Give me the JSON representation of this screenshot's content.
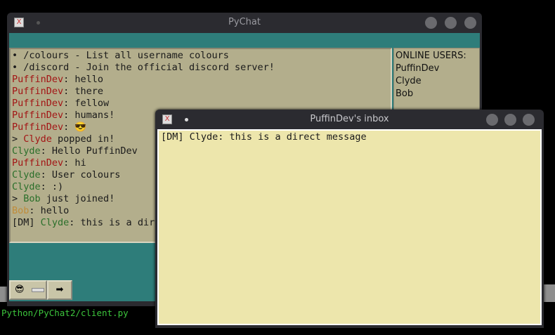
{
  "terminal": {
    "path": "Python/PyChat2/client.py"
  },
  "main_window": {
    "title": "PyChat",
    "messages": [
      {
        "pre": "• /colours - List all username colours"
      },
      {
        "pre": "• /discord - Join the official discord server!"
      },
      {
        "user": "PuffinDev",
        "color": "r",
        "text": ": hello"
      },
      {
        "user": "PuffinDev",
        "color": "r",
        "text": ": there"
      },
      {
        "user": "PuffinDev",
        "color": "r",
        "text": ": fellow"
      },
      {
        "user": "PuffinDev",
        "color": "r",
        "text": ": humans!"
      },
      {
        "user": "PuffinDev",
        "color": "r",
        "text": ": 😎"
      },
      {
        "pre": "> ",
        "user": "Clyde",
        "color": "r",
        "text": " popped in!"
      },
      {
        "user": "Clyde",
        "color": "g",
        "text": ": Hello PuffinDev"
      },
      {
        "user": "PuffinDev",
        "color": "r",
        "text": ": hi"
      },
      {
        "user": "Clyde",
        "color": "g",
        "text": ": User colours"
      },
      {
        "user": "Clyde",
        "color": "g",
        "text": ": :)"
      },
      {
        "pre": "> ",
        "user": "Bob",
        "color": "g",
        "text": " just joined!"
      },
      {
        "user": "Bob",
        "color": "o",
        "text": ": hello"
      },
      {
        "pre": "[DM] ",
        "user": "Clyde",
        "color": "g",
        "text": ": this is a direct message"
      }
    ],
    "online": {
      "heading": "ONLINE USERS:",
      "users": [
        "PuffinDev",
        "Clyde",
        "Bob"
      ]
    },
    "emoji_button": "😎",
    "send_button": "➡"
  },
  "inbox_window": {
    "title": "PuffinDev's inbox",
    "messages": [
      "[DM] Clyde: this is a direct message"
    ]
  }
}
